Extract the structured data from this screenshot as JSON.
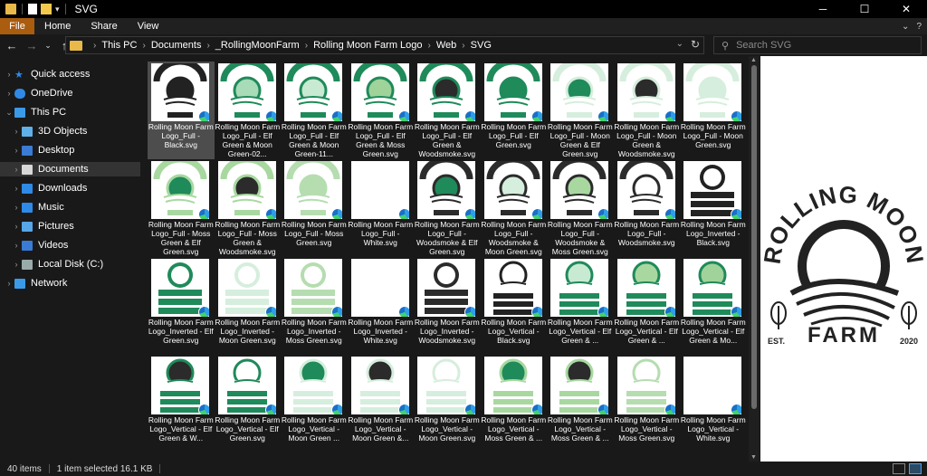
{
  "window": {
    "title": "SVG"
  },
  "ribbon": {
    "tabs": [
      "File",
      "Home",
      "Share",
      "View"
    ]
  },
  "address": {
    "crumbs": [
      "This PC",
      "Documents",
      "_RollingMoonFarm",
      "Rolling Moon Farm Logo",
      "Web",
      "SVG"
    ]
  },
  "search": {
    "placeholder": "Search SVG"
  },
  "sidebar": {
    "items": [
      {
        "label": "Quick access",
        "icon": "star-icon"
      },
      {
        "label": "OneDrive",
        "icon": "cloud-icon"
      },
      {
        "label": "This PC",
        "icon": "computer-icon"
      },
      {
        "label": "3D Objects",
        "icon": "cube-icon"
      },
      {
        "label": "Desktop",
        "icon": "desktop-icon"
      },
      {
        "label": "Documents",
        "icon": "documents-icon"
      },
      {
        "label": "Downloads",
        "icon": "download-icon"
      },
      {
        "label": "Music",
        "icon": "music-icon"
      },
      {
        "label": "Pictures",
        "icon": "pictures-icon"
      },
      {
        "label": "Videos",
        "icon": "videos-icon"
      },
      {
        "label": "Local Disk (C:)",
        "icon": "disk-icon"
      },
      {
        "label": "Network",
        "icon": "network-icon"
      }
    ]
  },
  "files": [
    {
      "name": "Rolling Moon Farm Logo_Full - Black.svg",
      "style": "full",
      "ink": "#222222",
      "moon": "#222222",
      "selected": true
    },
    {
      "name": "Rolling Moon Farm Logo_Full - Elf Green & Moon Green-02...",
      "style": "full",
      "ink": "#1f8a5a",
      "moon": "#a8dbb8"
    },
    {
      "name": "Rolling Moon Farm Logo_Full - Elf Green & Moon Green-11...",
      "style": "full",
      "ink": "#1f8a5a",
      "moon": "#c8ead2"
    },
    {
      "name": "Rolling Moon Farm Logo_Full - Elf Green & Moss Green.svg",
      "style": "full",
      "ink": "#1f8a5a",
      "moon": "#9fd39a"
    },
    {
      "name": "Rolling Moon Farm Logo_Full - Elf Green & Woodsmoke.svg",
      "style": "full",
      "ink": "#1f8a5a",
      "moon": "#2b2b2b"
    },
    {
      "name": "Rolling Moon Farm Logo_Full - Elf Green.svg",
      "style": "full",
      "ink": "#1f8a5a",
      "moon": "#1f8a5a"
    },
    {
      "name": "Rolling Moon Farm Logo_Full - Moon Green & Elf Green.svg",
      "style": "full",
      "ink": "#d6eedd",
      "moon": "#1f8a5a"
    },
    {
      "name": "Rolling Moon Farm Logo_Full - Moon Green & Woodsmoke.svg",
      "style": "full",
      "ink": "#d6eedd",
      "moon": "#2b2b2b"
    },
    {
      "name": "Rolling Moon Farm Logo_Full - Moon Green.svg",
      "style": "full",
      "ink": "#d6eedd",
      "moon": "#d6eedd"
    },
    {
      "name": "Rolling Moon Farm Logo_Full - Moss Green & Elf Green.svg",
      "style": "full",
      "ink": "#a8d8a0",
      "moon": "#1f8a5a"
    },
    {
      "name": "Rolling Moon Farm Logo_Full - Moss Green & Woodsmoke.svg",
      "style": "full",
      "ink": "#a8d8a0",
      "moon": "#2b2b2b"
    },
    {
      "name": "Rolling Moon Farm Logo_Full - Moss Green.svg",
      "style": "full",
      "ink": "#b5ddb0",
      "moon": "#b5ddb0"
    },
    {
      "name": "Rolling Moon Farm Logo_Full - White.svg",
      "style": "blank",
      "ink": "#ffffff",
      "moon": "#ffffff"
    },
    {
      "name": "Rolling Moon Farm Logo_Full - Woodsmoke & Elf Green.svg",
      "style": "full",
      "ink": "#2b2b2b",
      "moon": "#1f8a5a"
    },
    {
      "name": "Rolling Moon Farm Logo_Full - Woodsmoke & Moon Green.svg",
      "style": "full",
      "ink": "#2b2b2b",
      "moon": "#d6eedd"
    },
    {
      "name": "Rolling Moon Farm Logo_Full - Woodsmoke & Moss Green.svg",
      "style": "full",
      "ink": "#2b2b2b",
      "moon": "#a8d8a0"
    },
    {
      "name": "Rolling Moon Farm Logo_Full - Woodsmoke.svg",
      "style": "full",
      "ink": "#2b2b2b",
      "moon": "#ffffff"
    },
    {
      "name": "Rolling Moon Farm Logo_Inverted - Black.svg",
      "style": "inverted",
      "ink": "#222222",
      "moon": "#222222"
    },
    {
      "name": "Rolling Moon Farm Logo_Inverted - Elf Green.svg",
      "style": "inverted",
      "ink": "#1f8a5a",
      "moon": "#1f8a5a"
    },
    {
      "name": "Rolling Moon Farm Logo_Inverted - Moon Green.svg",
      "style": "inverted",
      "ink": "#d6eedd",
      "moon": "#d6eedd"
    },
    {
      "name": "Rolling Moon Farm Logo_Inverted - Moss Green.svg",
      "style": "inverted",
      "ink": "#b5ddb0",
      "moon": "#b5ddb0"
    },
    {
      "name": "Rolling Moon Farm Logo_Inverted - White.svg",
      "style": "blank",
      "ink": "#ffffff",
      "moon": "#ffffff"
    },
    {
      "name": "Rolling Moon Farm Logo_Inverted - Woodsmoke.svg",
      "style": "inverted",
      "ink": "#2b2b2b",
      "moon": "#2b2b2b"
    },
    {
      "name": "Rolling Moon Farm Logo_Vertical - Black.svg",
      "style": "vertical",
      "ink": "#222222",
      "moon": "#ffffff"
    },
    {
      "name": "Rolling Moon Farm Logo_Vertical - Elf Green & ...",
      "style": "vertical",
      "ink": "#1f8a5a",
      "moon": "#c8ead2"
    },
    {
      "name": "Rolling Moon Farm Logo_Vertical - Elf Green & ...",
      "style": "vertical",
      "ink": "#1f8a5a",
      "moon": "#a8d8a0"
    },
    {
      "name": "Rolling Moon Farm Logo_Vertical - Elf Green & Mo...",
      "style": "vertical",
      "ink": "#1f8a5a",
      "moon": "#9fd39a"
    },
    {
      "name": "Rolling Moon Farm Logo_Vertical - Elf Green & W...",
      "style": "vertical",
      "ink": "#1f8a5a",
      "moon": "#2b2b2b"
    },
    {
      "name": "Rolling Moon Farm Logo_Vertical - Elf Green.svg",
      "style": "vertical",
      "ink": "#1f8a5a",
      "moon": "#ffffff"
    },
    {
      "name": "Rolling Moon Farm Logo_Vertical - Moon Green ...",
      "style": "vertical",
      "ink": "#d6eedd",
      "moon": "#1f8a5a"
    },
    {
      "name": "Rolling Moon Farm Logo_Vertical - Moon Green &...",
      "style": "vertical",
      "ink": "#d6eedd",
      "moon": "#2b2b2b"
    },
    {
      "name": "Rolling Moon Farm Logo_Vertical - Moon Green.svg",
      "style": "vertical",
      "ink": "#d6eedd",
      "moon": "#ffffff"
    },
    {
      "name": "Rolling Moon Farm Logo_Vertical - Moss Green & ...",
      "style": "vertical",
      "ink": "#a8d8a0",
      "moon": "#1f8a5a"
    },
    {
      "name": "Rolling Moon Farm Logo_Vertical - Moss Green & ...",
      "style": "vertical",
      "ink": "#a8d8a0",
      "moon": "#2b2b2b"
    },
    {
      "name": "Rolling Moon Farm Logo_Vertical - Moss Green.svg",
      "style": "vertical",
      "ink": "#b5ddb0",
      "moon": "#ffffff"
    },
    {
      "name": "Rolling Moon Farm Logo_Vertical - White.svg",
      "style": "blank",
      "ink": "#ffffff",
      "moon": "#ffffff"
    }
  ],
  "preview": {
    "wordmark_top": "ROLLING MOON",
    "wordmark_bottom": "FARM",
    "est": "EST.",
    "year": "2020"
  },
  "status": {
    "count": "40 items",
    "selection": "1 item selected  16.1 KB"
  }
}
